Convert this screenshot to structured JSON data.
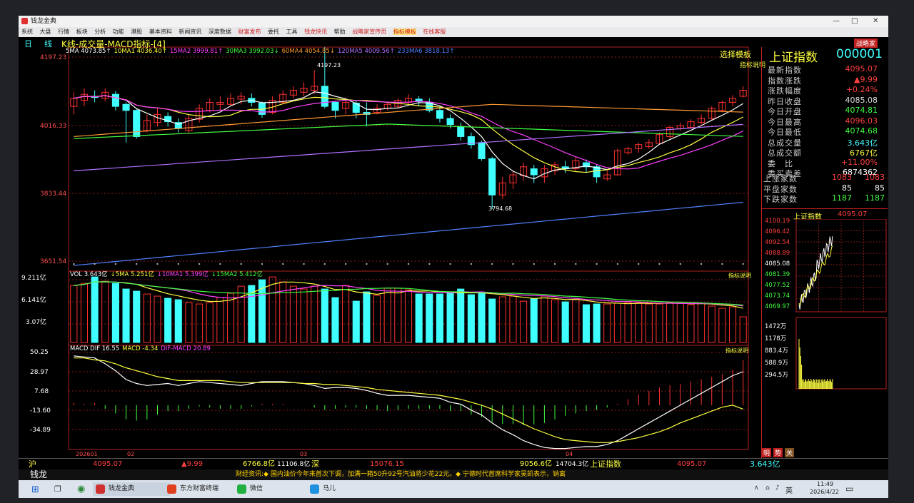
{
  "window": {
    "title": "钱龙金典"
  },
  "menu": [
    "系统",
    "大盘",
    "行情",
    "板块",
    "分析",
    "功能",
    "港股",
    "基本资料",
    "新闻资讯",
    "深度数据",
    "财富发布",
    "委托",
    "工具",
    "钱龙快讯",
    "帮助",
    "战略家宣传页",
    "指标模板",
    "在线客服"
  ],
  "chart_header": {
    "period_tab": "日",
    "period_tab2": "线",
    "title": "K线-成交量-MACD指标-[4]",
    "select_template": "选择模板",
    "indicator_note": "指标说明",
    "brand_badge": "战略家"
  },
  "ma_legend": [
    {
      "text": "5MA 4073.85↑",
      "color": "#ffffff"
    },
    {
      "text": "10MA1 4036.40↑",
      "color": "#ffff40"
    },
    {
      "text": "15MA2 3999.81↑",
      "color": "#ff40ff"
    },
    {
      "text": "30MA3 3992.03↓",
      "color": "#40ff40"
    },
    {
      "text": "60MA4 4054.85↓",
      "color": "#ff9933"
    },
    {
      "text": "120MA5 4009.56↑",
      "color": "#b070ff"
    },
    {
      "text": "233MA6 3818.13↑",
      "color": "#5080ff"
    }
  ],
  "price_axis": [
    "4197.23",
    "4016.33",
    "3833.44",
    "3651.54"
  ],
  "price_annotations": {
    "high": "4197.23",
    "low": "3794.68"
  },
  "vol_legend": [
    {
      "text": "VOL 3.643亿",
      "color": "#ffffff"
    },
    {
      "text": "↓5MA 5.251亿",
      "color": "#ffff40"
    },
    {
      "text": "↓10MA1 5.399亿",
      "color": "#ff40ff"
    },
    {
      "text": "↓15MA2 5.412亿",
      "color": "#40ff40"
    }
  ],
  "vol_axis": [
    "9.211亿",
    "6.141亿",
    "3.07亿"
  ],
  "macd_legend": [
    {
      "text": "MACD DIF 16.55",
      "color": "#ffffff"
    },
    {
      "text": "MACD -4.34",
      "color": "#ffff40"
    },
    {
      "text": "DIF-MACD 20.89",
      "color": "#ff40ff"
    }
  ],
  "macd_axis": [
    "50.25",
    "28.97",
    "7.68",
    "-13.60",
    "-34.89"
  ],
  "date_axis": [
    "202601",
    "02",
    "03",
    "04"
  ],
  "quote": {
    "name": "上证指数",
    "code": "000001",
    "rows": [
      {
        "label": "最新指数",
        "value": "4095.07",
        "color": "#ff4040"
      },
      {
        "label": "指数涨跌",
        "value": "▲9.99",
        "color": "#ff4040"
      },
      {
        "label": "涨跌幅度",
        "value": "+0.24%",
        "color": "#ff4040"
      },
      {
        "label": "昨日收盘",
        "value": "4085.08",
        "color": "#dddddd"
      },
      {
        "label": "今日开盘",
        "value": "4074.81",
        "color": "#40ff40"
      },
      {
        "label": "今日最高",
        "value": "4096.03",
        "color": "#ff4040"
      },
      {
        "label": "今日最低",
        "value": "4074.68",
        "color": "#40ff40"
      },
      {
        "label": "总成交量",
        "value": "3.643亿",
        "color": "#40ffff"
      },
      {
        "label": "总成交额",
        "value": "6767亿",
        "color": "#ffff40"
      },
      {
        "label": "委　比",
        "value": "+11.00%",
        "color": "#ff4040"
      },
      {
        "label": "委买卖差",
        "value": "6874362",
        "color": "#ffffff"
      }
    ],
    "breadth": [
      {
        "label": "上涨家数",
        "v1": "1083",
        "v2": "1083",
        "color": "#ff4040"
      },
      {
        "label": "平盘家数",
        "v1": "85",
        "v2": "85",
        "color": "#ffffff"
      },
      {
        "label": "下跌家数",
        "v1": "1187",
        "v2": "1187",
        "color": "#40ff40"
      }
    ]
  },
  "mini_chart": {
    "title": "上证指数",
    "last": "4095.07",
    "price_labels": [
      "4100.19",
      "4096.42",
      "4092.54",
      "4088.89",
      "4085.08",
      "4081.39",
      "4077.52",
      "4073.74",
      "4069.97"
    ],
    "vol_labels": [
      "1472万",
      "1178万",
      "883.4万",
      "588.9万",
      "294.5万"
    ]
  },
  "tabs_small": [
    "明",
    "势",
    "关"
  ],
  "status": {
    "sh_label": "沪",
    "sh_index": "4095.07",
    "sh_change": "▲9.99",
    "sh_amount": "6766.8亿",
    "sh_vol": "11106.8亿",
    "sz_label": "深",
    "sz_index": "15076.15",
    "sz_amount": "9056.6亿",
    "sz_vol": "14704.3亿",
    "right_name": "上证指数",
    "right_index": "4095.07",
    "right_vol": "3.643亿"
  },
  "news": {
    "brand": "钱龙",
    "text": "财经资讯:◆ 国内油价今年来首次下调，加满一箱50升92号汽油将少花22元。◆ 宁德时代首席科学家吴凯表示，钠离"
  },
  "taskbar": {
    "apps": [
      "钱龙金典",
      "东方财富终端",
      "微信",
      "马儿"
    ],
    "ime": "英",
    "time": "11:49",
    "date": "2026/4/22"
  },
  "chart_data": {
    "type": "candlestick",
    "price_range": [
      3651.54,
      4197.23
    ],
    "candles": [
      [
        4050,
        4070,
        4030,
        4085
      ],
      [
        4065,
        4080,
        4050,
        4095
      ],
      [
        4075,
        4072,
        4060,
        4090
      ],
      [
        4070,
        4085,
        4062,
        4095
      ],
      [
        4080,
        4050,
        4040,
        4088
      ],
      [
        4055,
        4040,
        3960,
        4060
      ],
      [
        4040,
        3975,
        3970,
        4045
      ],
      [
        3990,
        4015,
        3985,
        4030
      ],
      [
        4010,
        4030,
        4000,
        4045
      ],
      [
        4025,
        4012,
        4000,
        4035
      ],
      [
        4010,
        3995,
        3985,
        4020
      ],
      [
        3990,
        4020,
        3985,
        4030
      ],
      [
        4018,
        4045,
        4010,
        4055
      ],
      [
        4040,
        4060,
        4035,
        4070
      ],
      [
        4055,
        4060,
        4040,
        4075
      ],
      [
        4055,
        4070,
        4050,
        4082
      ],
      [
        4068,
        4075,
        4055,
        4085
      ],
      [
        4070,
        4060,
        4050,
        4082
      ],
      [
        4058,
        4030,
        4022,
        4062
      ],
      [
        4035,
        4065,
        4030,
        4075
      ],
      [
        4060,
        4080,
        4055,
        4090
      ],
      [
        4078,
        4090,
        4070,
        4100
      ],
      [
        4085,
        4095,
        4075,
        4110
      ],
      [
        4090,
        4100,
        4080,
        4140
      ],
      [
        4100,
        4050,
        4045,
        4197
      ],
      [
        4060,
        4040,
        4020,
        4062
      ],
      [
        4045,
        4060,
        4030,
        4070
      ],
      [
        4058,
        4035,
        4020,
        4065
      ],
      [
        4035,
        4030,
        4000,
        4060
      ],
      [
        4035,
        4045,
        4030,
        4055
      ],
      [
        4045,
        4055,
        4040,
        4060
      ],
      [
        4050,
        4065,
        4045,
        4070
      ],
      [
        4060,
        4070,
        4055,
        4080
      ],
      [
        4068,
        4062,
        4050,
        4075
      ],
      [
        4060,
        4040,
        4035,
        4070
      ],
      [
        4040,
        4020,
        4010,
        4050
      ],
      [
        4020,
        4005,
        3995,
        4030
      ],
      [
        4000,
        3975,
        3965,
        4010
      ],
      [
        3975,
        3955,
        3945,
        3985
      ],
      [
        3960,
        3920,
        3915,
        3965
      ],
      [
        3920,
        3830,
        3795,
        3925
      ],
      [
        3830,
        3860,
        3820,
        3875
      ],
      [
        3860,
        3880,
        3845,
        3890
      ],
      [
        3878,
        3900,
        3865,
        3910
      ],
      [
        3895,
        3880,
        3860,
        3905
      ],
      [
        3875,
        3895,
        3860,
        3905
      ],
      [
        3890,
        3905,
        3880,
        3912
      ],
      [
        3900,
        3895,
        3885,
        3915
      ],
      [
        3895,
        3915,
        3890,
        3925
      ],
      [
        3910,
        3900,
        3885,
        3918
      ],
      [
        3900,
        3875,
        3860,
        3905
      ],
      [
        3870,
        3880,
        3865,
        3890
      ],
      [
        3880,
        3940,
        3878,
        3945
      ],
      [
        3935,
        3945,
        3930,
        3950
      ],
      [
        3945,
        3955,
        3935,
        3960
      ],
      [
        3950,
        3960,
        3945,
        3968
      ],
      [
        3958,
        3980,
        3955,
        3985
      ],
      [
        3975,
        3998,
        3970,
        4002
      ],
      [
        3995,
        4002,
        3990,
        4010
      ],
      [
        3998,
        4012,
        3995,
        4018
      ],
      [
        4010,
        4020,
        4005,
        4030
      ],
      [
        4020,
        4045,
        4015,
        4050
      ],
      [
        4040,
        4060,
        4035,
        4065
      ],
      [
        4060,
        4070,
        4050,
        4078
      ],
      [
        4075,
        4090,
        4072,
        4100
      ]
    ],
    "volume_max": 9.211,
    "volumes": [
      8.0,
      8.3,
      9.2,
      8.6,
      8.3,
      7.5,
      7.2,
      6.8,
      6.5,
      6.2,
      6.0,
      5.6,
      5.4,
      5.6,
      6.3,
      6.9,
      7.9,
      8.0,
      8.8,
      9.2,
      8.5,
      7.9,
      7.5,
      7.9,
      7.5,
      6.3,
      8.0,
      5.8,
      7.1,
      6.6,
      7.6,
      7.6,
      7.4,
      6.8,
      6.8,
      6.8,
      7.0,
      7.5,
      6.7,
      6.9,
      6.1,
      6.4,
      6.5,
      5.8,
      6.1,
      6.5,
      6.0,
      5.7,
      6.0,
      5.3,
      5.4,
      5.4,
      5.5,
      5.6,
      5.6,
      5.4,
      5.4,
      5.6,
      5.5,
      5.3,
      5.5,
      5.1,
      4.8,
      5.0,
      3.6
    ],
    "macd_range": [
      -45,
      55
    ],
    "dif": [
      50,
      49,
      48,
      42,
      35,
      26,
      22,
      20,
      21,
      22,
      20,
      22,
      24,
      23,
      22,
      21,
      20,
      22,
      24,
      24,
      24,
      23,
      22,
      20,
      17,
      18,
      18,
      17,
      15,
      12,
      10,
      10,
      10,
      9,
      8,
      7,
      3,
      1,
      -5,
      -10,
      -18,
      -25,
      -30,
      -36,
      -40,
      -43,
      -44,
      -44,
      -43,
      -42,
      -42,
      -40,
      -36,
      -30,
      -24,
      -18,
      -12,
      -6,
      0,
      6,
      12,
      18,
      24,
      30,
      34
    ],
    "macd": [
      48,
      48,
      46,
      45,
      42,
      38,
      35,
      32,
      29,
      27,
      25,
      25,
      25,
      25,
      25,
      24,
      23,
      23,
      23,
      23,
      23,
      23,
      22,
      22,
      21,
      21,
      20,
      19,
      18,
      16,
      15,
      14,
      13,
      12,
      11,
      10,
      8,
      6,
      3,
      0,
      -4,
      -9,
      -14,
      -19,
      -24,
      -28,
      -32,
      -35,
      -36,
      -37,
      -38,
      -38,
      -37,
      -35,
      -33,
      -30,
      -27,
      -23,
      -18,
      -14,
      -10,
      -6,
      -2,
      0,
      -4
    ]
  }
}
